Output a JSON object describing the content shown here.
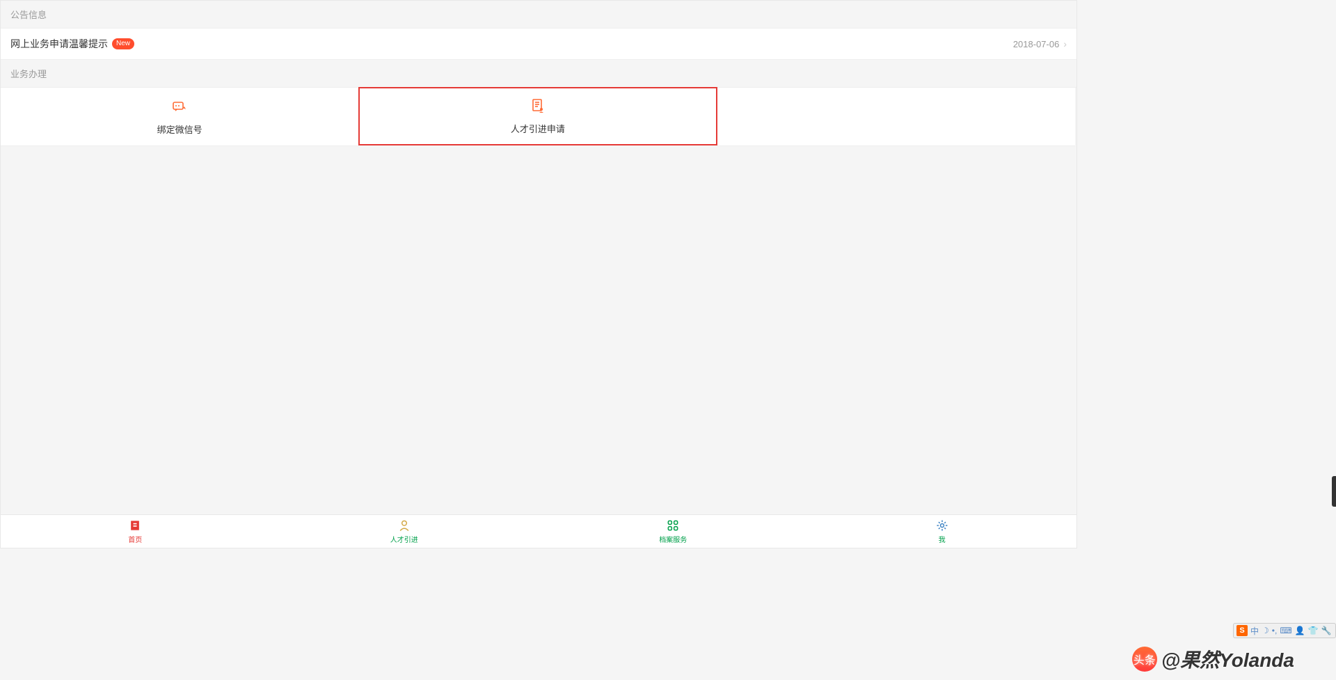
{
  "announcements": {
    "header": "公告信息",
    "item": {
      "title": "网上业务申请温馨提示",
      "badge": "New",
      "date": "2018-07-06"
    }
  },
  "business": {
    "header": "业务办理",
    "cards": {
      "bind_wechat": "绑定微信号",
      "talent_apply": "人才引进申请"
    }
  },
  "bottom_nav": {
    "home": "首页",
    "talent": "人才引进",
    "archive": "档案服务",
    "me": "我"
  },
  "ime": {
    "logo": "S",
    "lang": "中"
  },
  "watermark": {
    "prefix": "头条",
    "text": "@果然Yolanda"
  },
  "colors": {
    "accent": "#ff6b35",
    "highlight_border": "#e53935"
  }
}
